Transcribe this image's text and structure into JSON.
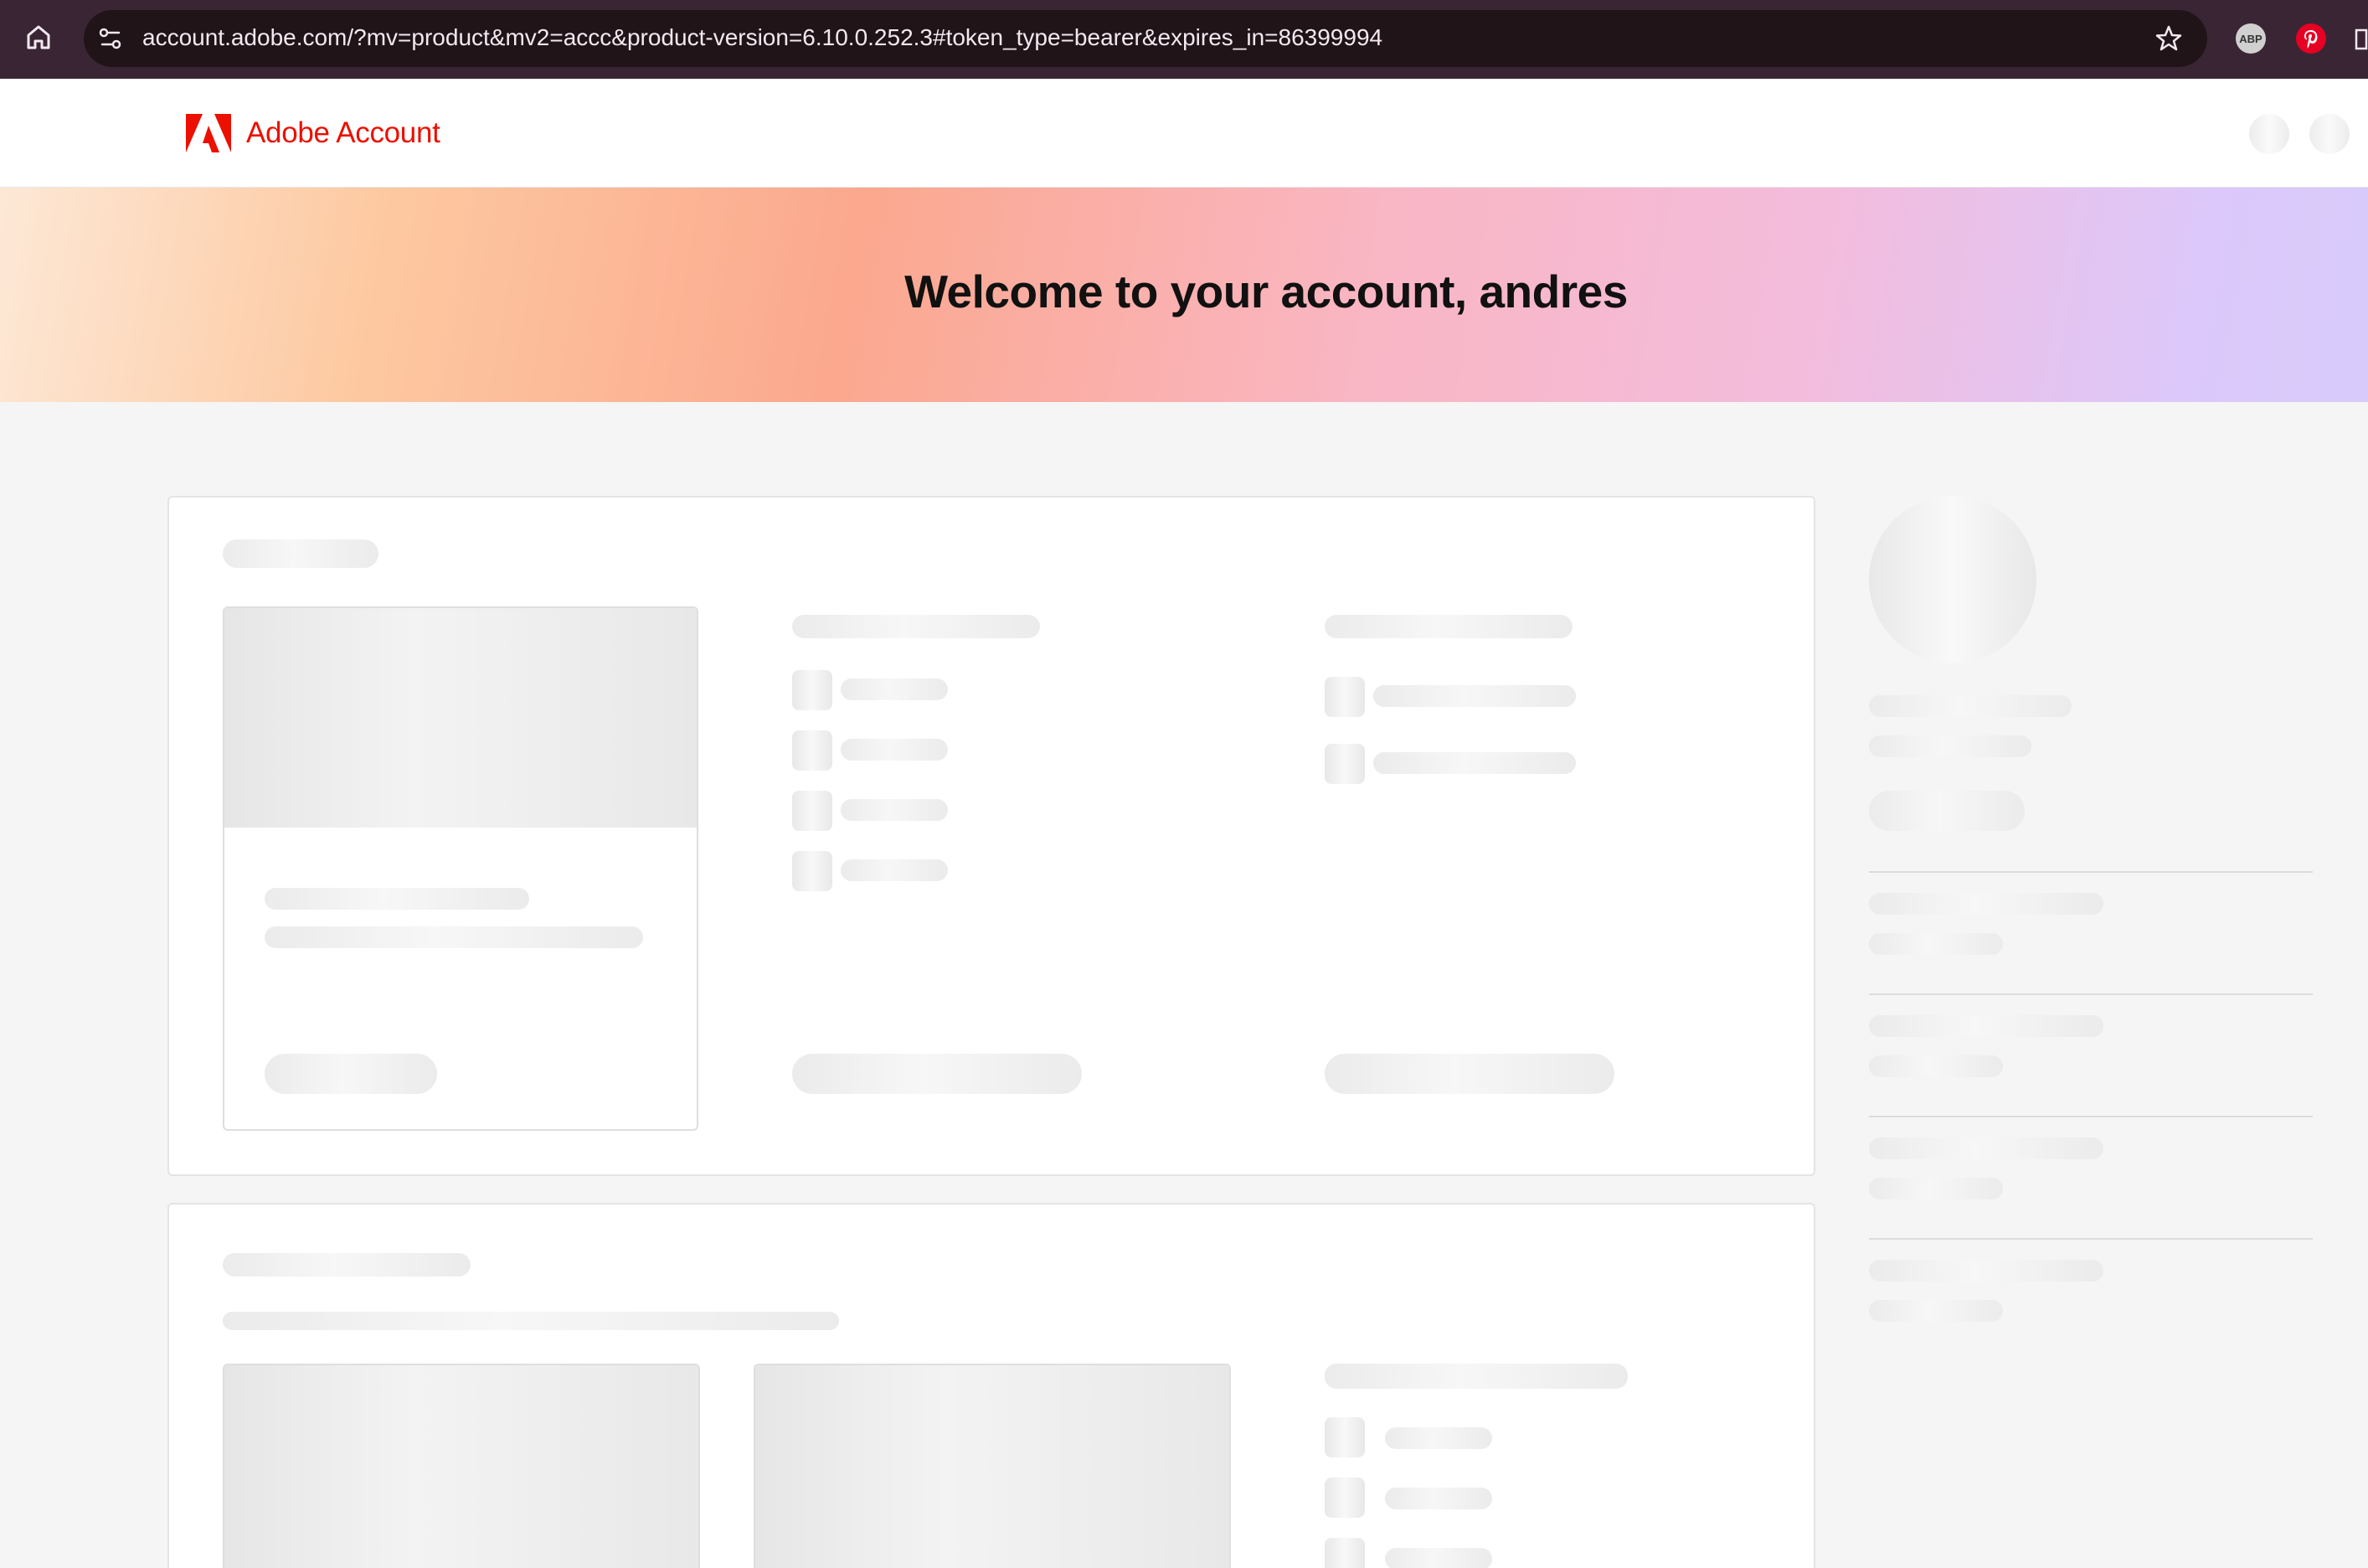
{
  "browser": {
    "url": "account.adobe.com/?mv=product&mv2=accc&product-version=6.10.0.252.3#token_type=bearer&expires_in=86399994",
    "extensions": {
      "abp_label": "ABP"
    }
  },
  "header": {
    "brand": "Adobe Account"
  },
  "hero": {
    "welcome": "Welcome to your account, andres"
  },
  "colors": {
    "brand_red": "#eb1000",
    "chrome_bg": "#3a2535",
    "skeleton": "#ebebeb"
  },
  "state": {
    "loading": true
  }
}
